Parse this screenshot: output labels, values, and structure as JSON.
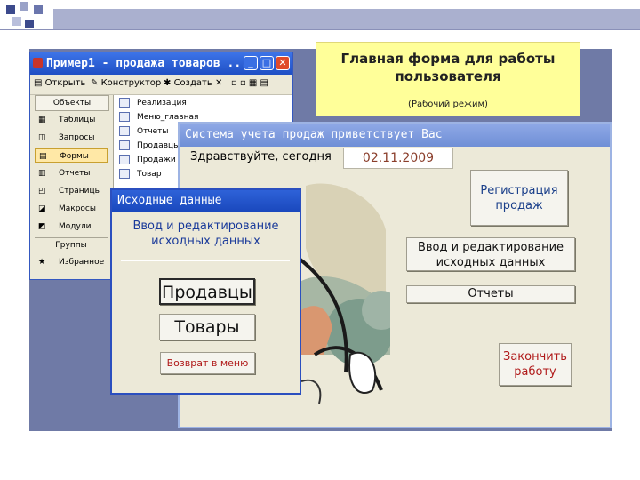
{
  "caption": {
    "title_line1": "Главная форма для работы",
    "title_line2": "пользователя",
    "subtitle": "(Рабочий режим)"
  },
  "db_window": {
    "title": "Пример1 - продажа товаров ...",
    "toolbar": {
      "open": "Открыть",
      "design": "Конструктор",
      "create": "Создать"
    },
    "objects_header": "Объекты",
    "objects": [
      "Таблицы",
      "Запросы",
      "Формы",
      "Отчеты",
      "Страницы",
      "Макросы",
      "Модули"
    ],
    "selected_object": "Формы",
    "groups_label": "Группы",
    "favorites": "Избранное",
    "forms_list": [
      "Реализация",
      "Меню_главная",
      "Отчеты",
      "Продавцы",
      "Продажи",
      "Товар"
    ]
  },
  "main_form": {
    "title": "Система учета продаж приветствует Вас",
    "greeting": "Здравствуйте, сегодня",
    "date": "02.11.2009",
    "btn_register_l1": "Регистрация",
    "btn_register_l2": "продаж",
    "btn_edit_l1": "Ввод и редактирование",
    "btn_edit_l2": "исходных данных",
    "btn_reports": "Отчеты",
    "btn_finish_l1": "Закончить",
    "btn_finish_l2": "работу"
  },
  "sub_form": {
    "title": "Исходные данные",
    "heading_l1": "Ввод и редактирование",
    "heading_l2": "исходных данных",
    "btn_sellers": "Продавцы",
    "btn_goods": "Товары",
    "btn_back": "Возврат в меню"
  },
  "colors": {
    "xp_title_blue": "#1f4fc4",
    "inactive_title": "#8fa9e6",
    "caption_yellow": "#ffff99",
    "date_text": "#8a3d2a",
    "finish_text": "#b01a1a"
  }
}
